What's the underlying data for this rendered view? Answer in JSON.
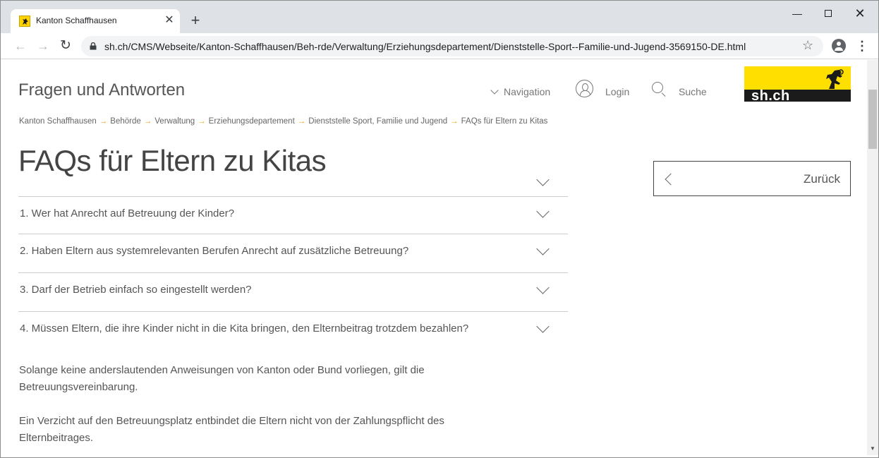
{
  "browser": {
    "tab_title": "Kanton Schaffhausen",
    "tab_close": "✕",
    "new_tab": "+",
    "url": "sh.ch/CMS/Webseite/Kanton-Schaffhausen/Beh-rde/Verwaltung/Erziehungsdepartement/Dienststelle-Sport--Familie-und-Jugend-3569150-DE.html",
    "window_min": "—",
    "window_close": "✕",
    "icons": [
      "back-icon",
      "forward-icon",
      "reload-icon",
      "lock-icon",
      "star-icon",
      "profile-icon",
      "menu-icon"
    ]
  },
  "header": {
    "site_title": "Fragen und Antworten",
    "navigation": "Navigation",
    "login": "Login",
    "search": "Suche",
    "logo_text": "sh.ch",
    "logo_colors": {
      "yellow": "#ffdf00",
      "black": "#1b1b1b"
    }
  },
  "breadcrumb": [
    "Kanton Schaffhausen",
    "Behörde",
    "Verwaltung",
    "Erziehungsdepartement",
    "Dienststelle Sport, Familie und Jugend",
    "FAQs für Eltern zu Kitas"
  ],
  "breadcrumb_separator": "→",
  "page": {
    "title": "FAQs für Eltern zu Kitas",
    "back_button": "Zurück",
    "questions": [
      "1. Wer hat Anrecht auf Betreuung der Kinder?",
      "2. Haben Eltern aus systemrelevanten Berufen Anrecht auf zusätzliche Betreuung?",
      "3. Darf der Betrieb einfach so eingestellt werden?",
      "4. Müssen Eltern, die ihre Kinder nicht in die Kita bringen, den Elternbeitrag trotzdem bezahlen?"
    ],
    "answer_paragraphs": [
      "Solange keine anderslautenden Anweisungen von Kanton oder Bund vorliegen, gilt die Betreuungsvereinbarung.",
      "Ein Verzicht auf den Betreuungsplatz entbindet die Eltern nicht von der Zahlungspflicht des Elternbeitrages."
    ],
    "accent_color": "#e4a500"
  }
}
